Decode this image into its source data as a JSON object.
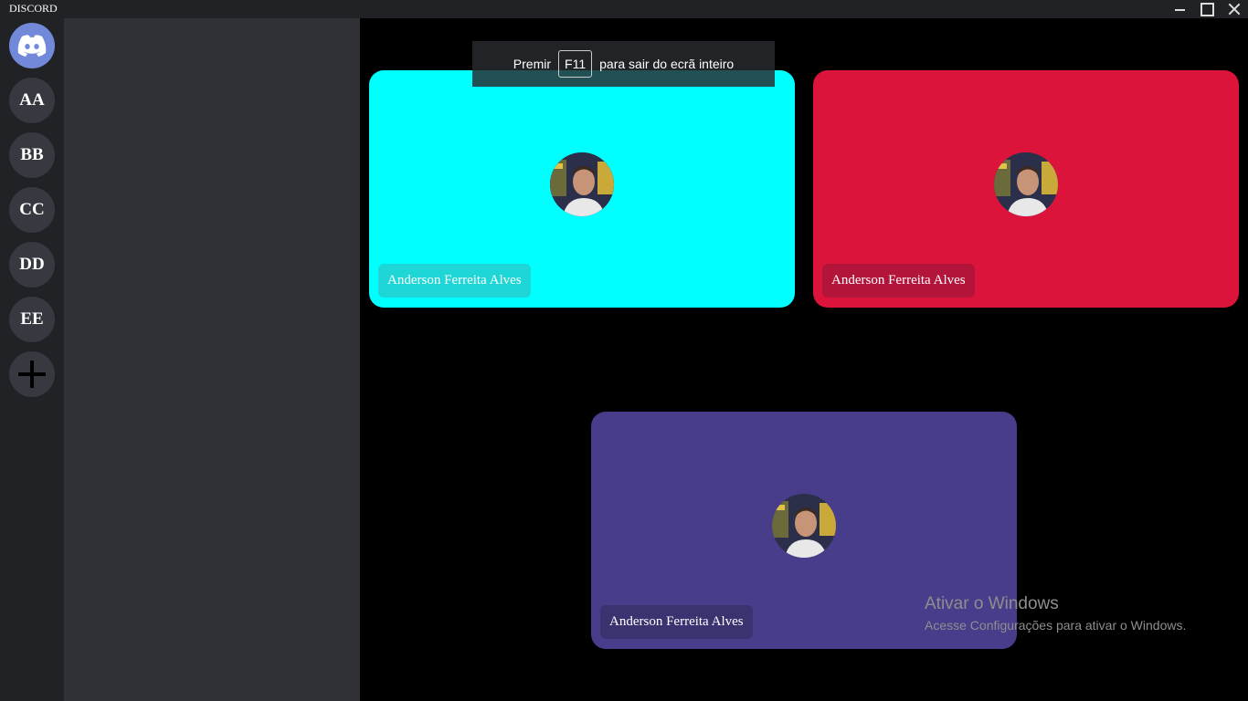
{
  "window": {
    "title": "DISCORD"
  },
  "servers": [
    {
      "label": "AA"
    },
    {
      "label": "BB"
    },
    {
      "label": "CC"
    },
    {
      "label": "DD"
    },
    {
      "label": "EE"
    }
  ],
  "fullscreen_hint": {
    "before": "Premir",
    "key": "F11",
    "after": "para sair do ecrã inteiro"
  },
  "participants": [
    {
      "name": "Anderson Ferreita Alves",
      "tile_color": "#00ffff",
      "tag_color": "#1fd6d6"
    },
    {
      "name": "Anderson Ferreita Alves",
      "tile_color": "#dc143c",
      "tag_color": "#b3153a"
    },
    {
      "name": "Anderson Ferreita Alves",
      "tile_color": "#483d8b",
      "tag_color": "#3b3270"
    }
  ],
  "watermark": {
    "title": "Ativar o Windows",
    "subtitle": "Acesse Configurações para ativar o Windows."
  },
  "colors": {
    "rail": "#202225",
    "channels": "#2f3136",
    "home_accent": "#7289da"
  }
}
